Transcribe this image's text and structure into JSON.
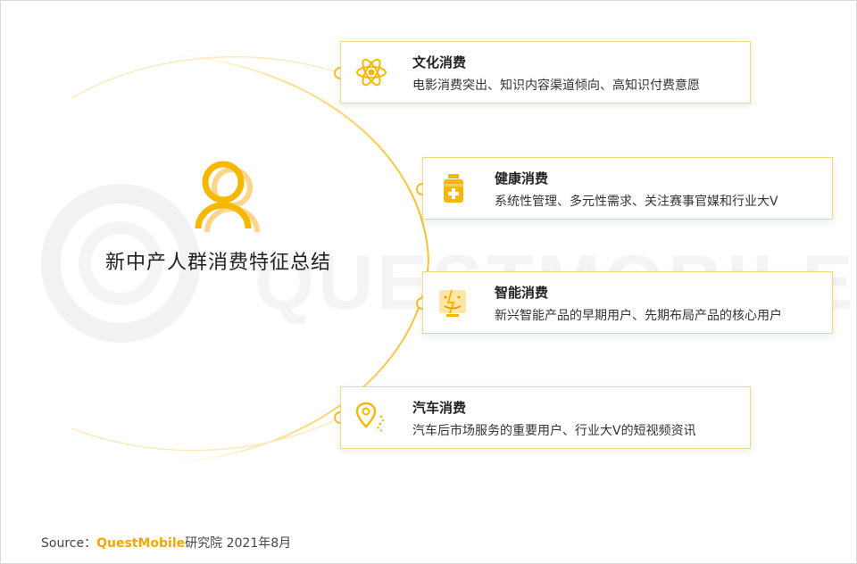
{
  "center": {
    "title": "新中产人群消费特征总结"
  },
  "watermark": {
    "text": "QUESTMOBILE"
  },
  "cards": [
    {
      "title": "文化消费",
      "desc": "电影消费突出、知识内容渠道倾向、高知识付费意愿",
      "icon": "atom-icon"
    },
    {
      "title": "健康消费",
      "desc": "系统性管理、多元性需求、关注赛事官媒和行业大V",
      "icon": "medicine-bottle-icon"
    },
    {
      "title": "智能消费",
      "desc": "新兴智能产品的早期用户、先期布局产品的核心用户",
      "icon": "smart-face-icon"
    },
    {
      "title": "汽车消费",
      "desc": "汽车后市场服务的重要用户、行业大V的短视频资讯",
      "icon": "location-route-icon"
    }
  ],
  "source": {
    "prefix": "Source：",
    "brand": "QuestMobile",
    "suffix": "研究院 2021年8月"
  },
  "colors": {
    "accent": "#f5b800",
    "border": "#f6d77a",
    "watermark": "#f4f4f4"
  }
}
